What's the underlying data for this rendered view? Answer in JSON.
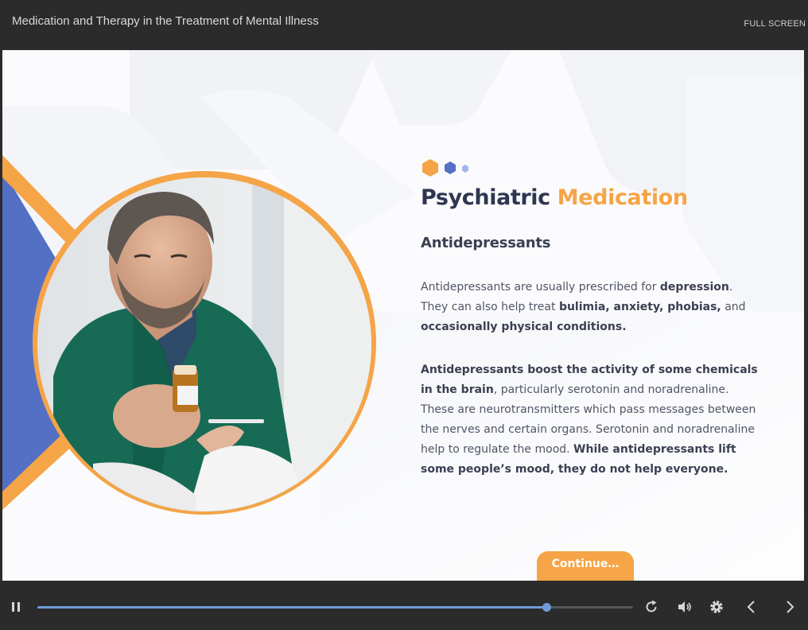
{
  "header": {
    "course_title": "Medication and Therapy in the Treatment of Mental Illness",
    "fullscreen_label": "FULL SCREEN"
  },
  "slide": {
    "heading_part1": "Psychiatric",
    "heading_part2": "Medication",
    "subheading": "Antidepressants",
    "p1": [
      {
        "t": "Antidepressants are usually prescribed for ",
        "b": false
      },
      {
        "t": "depression",
        "b": true
      },
      {
        "t": ". They can also help treat ",
        "b": false
      },
      {
        "t": "bulimia, anxiety, phobias,",
        "b": true
      },
      {
        "t": " and ",
        "b": false
      },
      {
        "t": "occasionally physical conditions.",
        "b": true
      }
    ],
    "p2": [
      {
        "t": "Antidepressants boost the activity of some chemicals in the brain",
        "b": true
      },
      {
        "t": ", particularly serotonin and noradrenaline. These are neurotransmitters which pass messages between the nerves and certain organs. Serotonin and noradrenaline help to regulate the mood. ",
        "b": false
      },
      {
        "t": "While antidepressants lift some people’s mood, they do not help everyone.",
        "b": true
      }
    ],
    "continue_label": "Continue…"
  },
  "player": {
    "progress": 0.855,
    "icons": [
      "pause-icon",
      "replay-icon",
      "volume-icon",
      "settings-icon",
      "prev-icon",
      "next-icon"
    ]
  },
  "colors": {
    "accent_orange": "#f5a447",
    "accent_blue": "#5470c4",
    "heading_dark": "#2f3650",
    "bar_bg": "#2b2b2b",
    "progress": "#6f9bd8"
  }
}
